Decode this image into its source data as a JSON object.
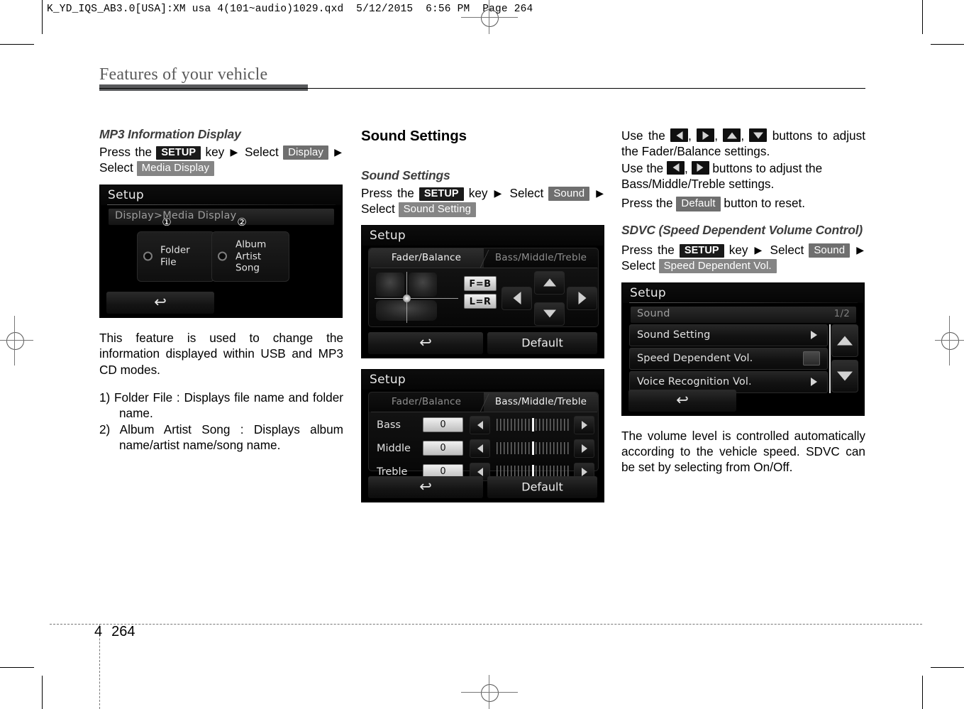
{
  "print_marks": {
    "file_line": "K_YD_IQS_AB3.0[USA]:XM usa 4(101~audio)1029.qxd  5/12/2015  6:56 PM  Page 264"
  },
  "page": {
    "header_title": "Features of your vehicle",
    "chapter_number": "4",
    "page_number": "264"
  },
  "column1": {
    "heading": "MP3 Information Display",
    "steps": {
      "press_the": "Press  the",
      "setup_key": "SETUP",
      "key_word": "key",
      "select_1": "Select",
      "token_display": "Display",
      "select_2": "Select",
      "token_media_display": "Media Display"
    },
    "screen": {
      "title": "Setup",
      "breadcrumb": "Display>Media Display",
      "option1_badge": "①",
      "option1_label": "Folder\nFile",
      "option1_line1": "Folder",
      "option1_line2": "File",
      "option2_badge": "②",
      "option2_line1": "Album",
      "option2_line2": "Artist",
      "option2_line3": "Song",
      "back_icon": "↩"
    },
    "paragraph": "This feature is used to change the information displayed within USB and MP3 CD modes.",
    "list": [
      "1) Folder File : Displays file name and folder name.",
      "2) Album Artist Song : Displays album name/artist name/song name."
    ]
  },
  "column2": {
    "section_heading": "Sound Settings",
    "sub_heading": "Sound Settings",
    "steps": {
      "press_the": "Press  the",
      "setup_key": "SETUP",
      "key_word": "key",
      "select_1": "Select",
      "token_sound": "Sound",
      "select_2": "Select",
      "token_sound_setting": "Sound Setting"
    },
    "screen_fader": {
      "title": "Setup",
      "tab_left": "Fader/Balance",
      "tab_right": "Bass/Middle/Treble",
      "chip_fb": "F=B",
      "chip_lr": "L=R",
      "back_icon": "↩",
      "default_label": "Default"
    },
    "screen_bmt": {
      "title": "Setup",
      "tab_left": "Fader/Balance",
      "tab_right": "Bass/Middle/Treble",
      "rows": [
        {
          "name": "Bass",
          "value": "0"
        },
        {
          "name": "Middle",
          "value": "0"
        },
        {
          "name": "Treble",
          "value": "0"
        }
      ],
      "back_icon": "↩",
      "default_label": "Default"
    }
  },
  "column3": {
    "para1_a": "Use the",
    "para1_b": "buttons to adjust the Fader/Balance settings.",
    "para2_a": "Use the",
    "para2_b": "buttons to adjust the Bass/Middle/Treble settings.",
    "para3_a": "Press the",
    "para3_token": "Default",
    "para3_b": "button to reset.",
    "sdvc_heading": "SDVC (Speed Dependent Volume Control)",
    "steps": {
      "press_the": "Press  the",
      "setup_key": "SETUP",
      "key_word": "key",
      "select_1": "Select",
      "token_sound": "Sound",
      "select_2": "Select",
      "token_speed_dependent": "Speed Dependent Vol."
    },
    "screen_sound": {
      "title": "Setup",
      "breadcrumb": "Sound",
      "page_indicator": "1/2",
      "items": [
        {
          "label": "Sound Setting",
          "control": "chevron"
        },
        {
          "label": "Speed Dependent Vol.",
          "control": "checkbox"
        },
        {
          "label": "Voice Recognition Vol.",
          "control": "chevron"
        }
      ],
      "back_icon": "↩"
    },
    "paragraph": "The volume level is controlled automatically according to the vehicle speed. SDVC can be set by selecting from On/Off."
  },
  "colors": {
    "token_black": "#1a1a1a",
    "token_gray": "#6f6f6f",
    "header_gray": "#58595b",
    "screen_bg": "#000000"
  }
}
